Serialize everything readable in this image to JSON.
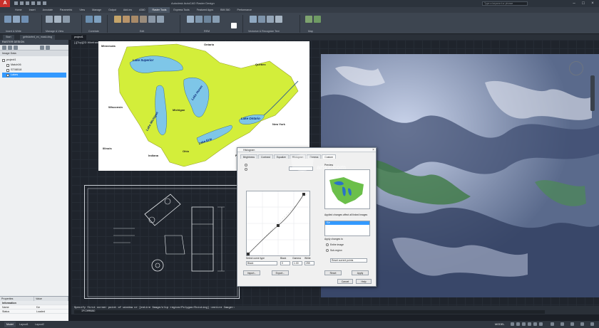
{
  "app": {
    "title": "Autodesk AutoCAD Raster Design",
    "search_placeholder": "Type a keyword or phrase"
  },
  "ribbon_tabs": [
    "Home",
    "Insert",
    "Annotate",
    "Parametric",
    "View",
    "Manage",
    "Output",
    "Add-ins",
    "A360",
    "Raster Tools",
    "Express Tools",
    "Featured Apps",
    "BIM 360",
    "Performance"
  ],
  "active_ribbon_tab": "Raster Tools",
  "ribbon_panels": [
    "Insert & Write",
    "Manage & View",
    "Correlate",
    "Edit",
    "REM",
    "Vectorize & Recognize Text",
    "Map"
  ],
  "doc_tabs": [
    "Start",
    "gettstarted_ex_mask.dwg",
    "project1"
  ],
  "left_panel": {
    "header": "RASTER DESIGN",
    "section_label": "Image Data",
    "tree": [
      {
        "label": "project1",
        "level": 0
      },
      {
        "label": "Match06",
        "level": 1
      },
      {
        "label": "ST08518",
        "level": 1
      },
      {
        "label": "Lakes",
        "level": 1
      }
    ],
    "properties": {
      "col_property": "Properties",
      "col_value": "Value",
      "section": "Information",
      "rows": [
        {
          "name": "Name",
          "value": "f1e"
        },
        {
          "name": "Status",
          "value": "Loaded"
        }
      ]
    }
  },
  "canvas": {
    "viewport_label": "[-][Top][2D Wireframe]"
  },
  "map": {
    "labels": {
      "ontario": "Ontario",
      "quebec": "Québec",
      "minnesota": "Minnesota",
      "wisconsin": "Wisconsin",
      "michigan": "Michigan",
      "illinois": "Illinois",
      "indiana": "Indiana",
      "ohio": "Ohio",
      "new_york": "New York",
      "pennsylvania": "Pennsylvania"
    },
    "lakes": {
      "superior": "Lake Superior",
      "michigan": "Lake Michigan",
      "huron": "Lake Huron",
      "erie": "Lake Erie",
      "ontario": "Lake Ontario"
    }
  },
  "dialog": {
    "title": "Histogram",
    "tabs": [
      "Brightness",
      "Contrast",
      "Equalize",
      "Histogram",
      "Gamma",
      "Custom"
    ],
    "curve_type_label": "Select curve type",
    "curve_type": "Black",
    "black_label": "Black",
    "black_value": "0",
    "gamma_label": "Gamma",
    "gamma_value": "1.00",
    "white_label": "White",
    "white_value": "255",
    "preview_label": "Preview",
    "applied_label": "Applied changes affect all linked images",
    "list_item": "f1e",
    "apply_to_label": "Apply changes to",
    "radio_entire": "Entire image",
    "radio_sub": "Sub-region",
    "sub_option": "Reset current points",
    "buttons": {
      "import": "Import...",
      "export": "Export...",
      "reset": "Reset",
      "apply": "Apply",
      "cancel": "Cancel",
      "help": "Help"
    }
  },
  "watermark": "anxz.com",
  "command": {
    "history": "Specify first corner point of window or [entire Image/clip region/Polygon/Existing] <entire Image>:",
    "input": "IPCOMMAND"
  },
  "statusbar": {
    "tabs": [
      "Model",
      "Layout1",
      "Layout2"
    ],
    "active": "Model",
    "mode": "MODEL"
  },
  "colors": {
    "accent": "#3399ff",
    "app_logo": "#c9302c",
    "map_land": "#d3ee3a",
    "map_water": "#7ec6e8"
  }
}
